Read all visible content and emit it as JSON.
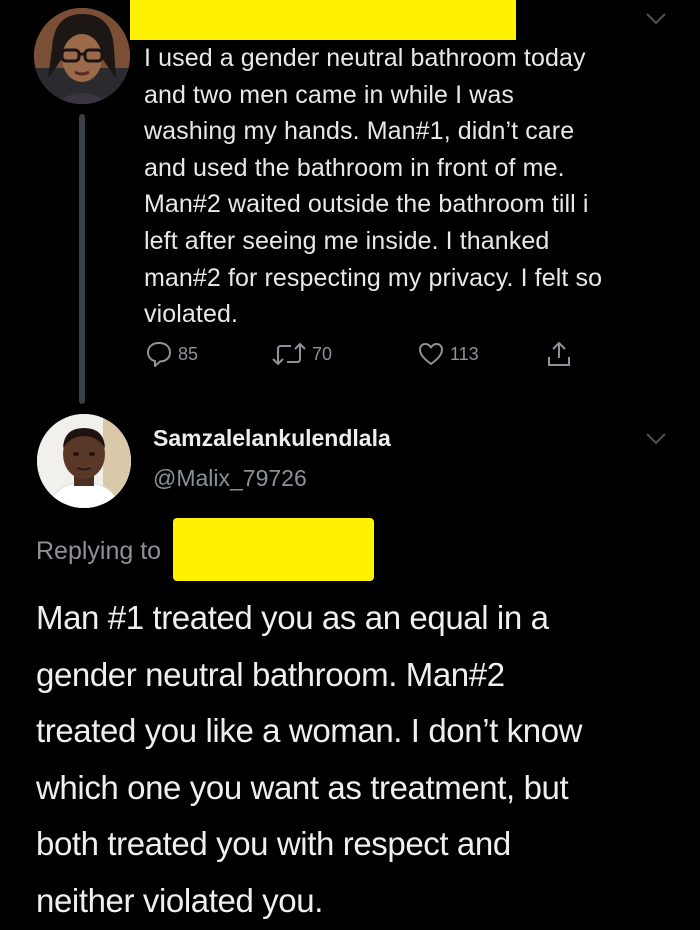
{
  "original_tweet": {
    "avatar": "profile-photo",
    "text": "I used a gender neutral bathroom today\nand two men came in while I was\nwashing my hands. Man#1, didn’t care\nand used the bathroom in front of me.\nMan#2 waited outside the bathroom till i\nleft after seeing me inside. I thanked\nman#2 for respecting my privacy. I felt so\nviolated.",
    "actions": {
      "reply_count": "85",
      "retweet_count": "70",
      "like_count": "113"
    }
  },
  "reply_tweet": {
    "avatar": "profile-photo",
    "display_name": "Samzalelankulendlala",
    "handle": "@Malix_79726",
    "replying_to_label": "Replying to",
    "text": "Man #1 treated you as an equal in a\ngender neutral bathroom. Man#2\ntreated you like a woman. I don’t know\nwhich one you want as treatment, but\nboth treated you with respect and\nneither violated you."
  },
  "colors": {
    "background": "#000000",
    "primary_text": "#e8e8e8",
    "secondary_text": "#8b9197",
    "redaction": "#fff200",
    "thread_line": "#3b4046"
  },
  "icons": {
    "reply": "reply-icon",
    "retweet": "retweet-icon",
    "like": "heart-icon",
    "share": "share-icon",
    "more": "chevron-down-icon"
  }
}
